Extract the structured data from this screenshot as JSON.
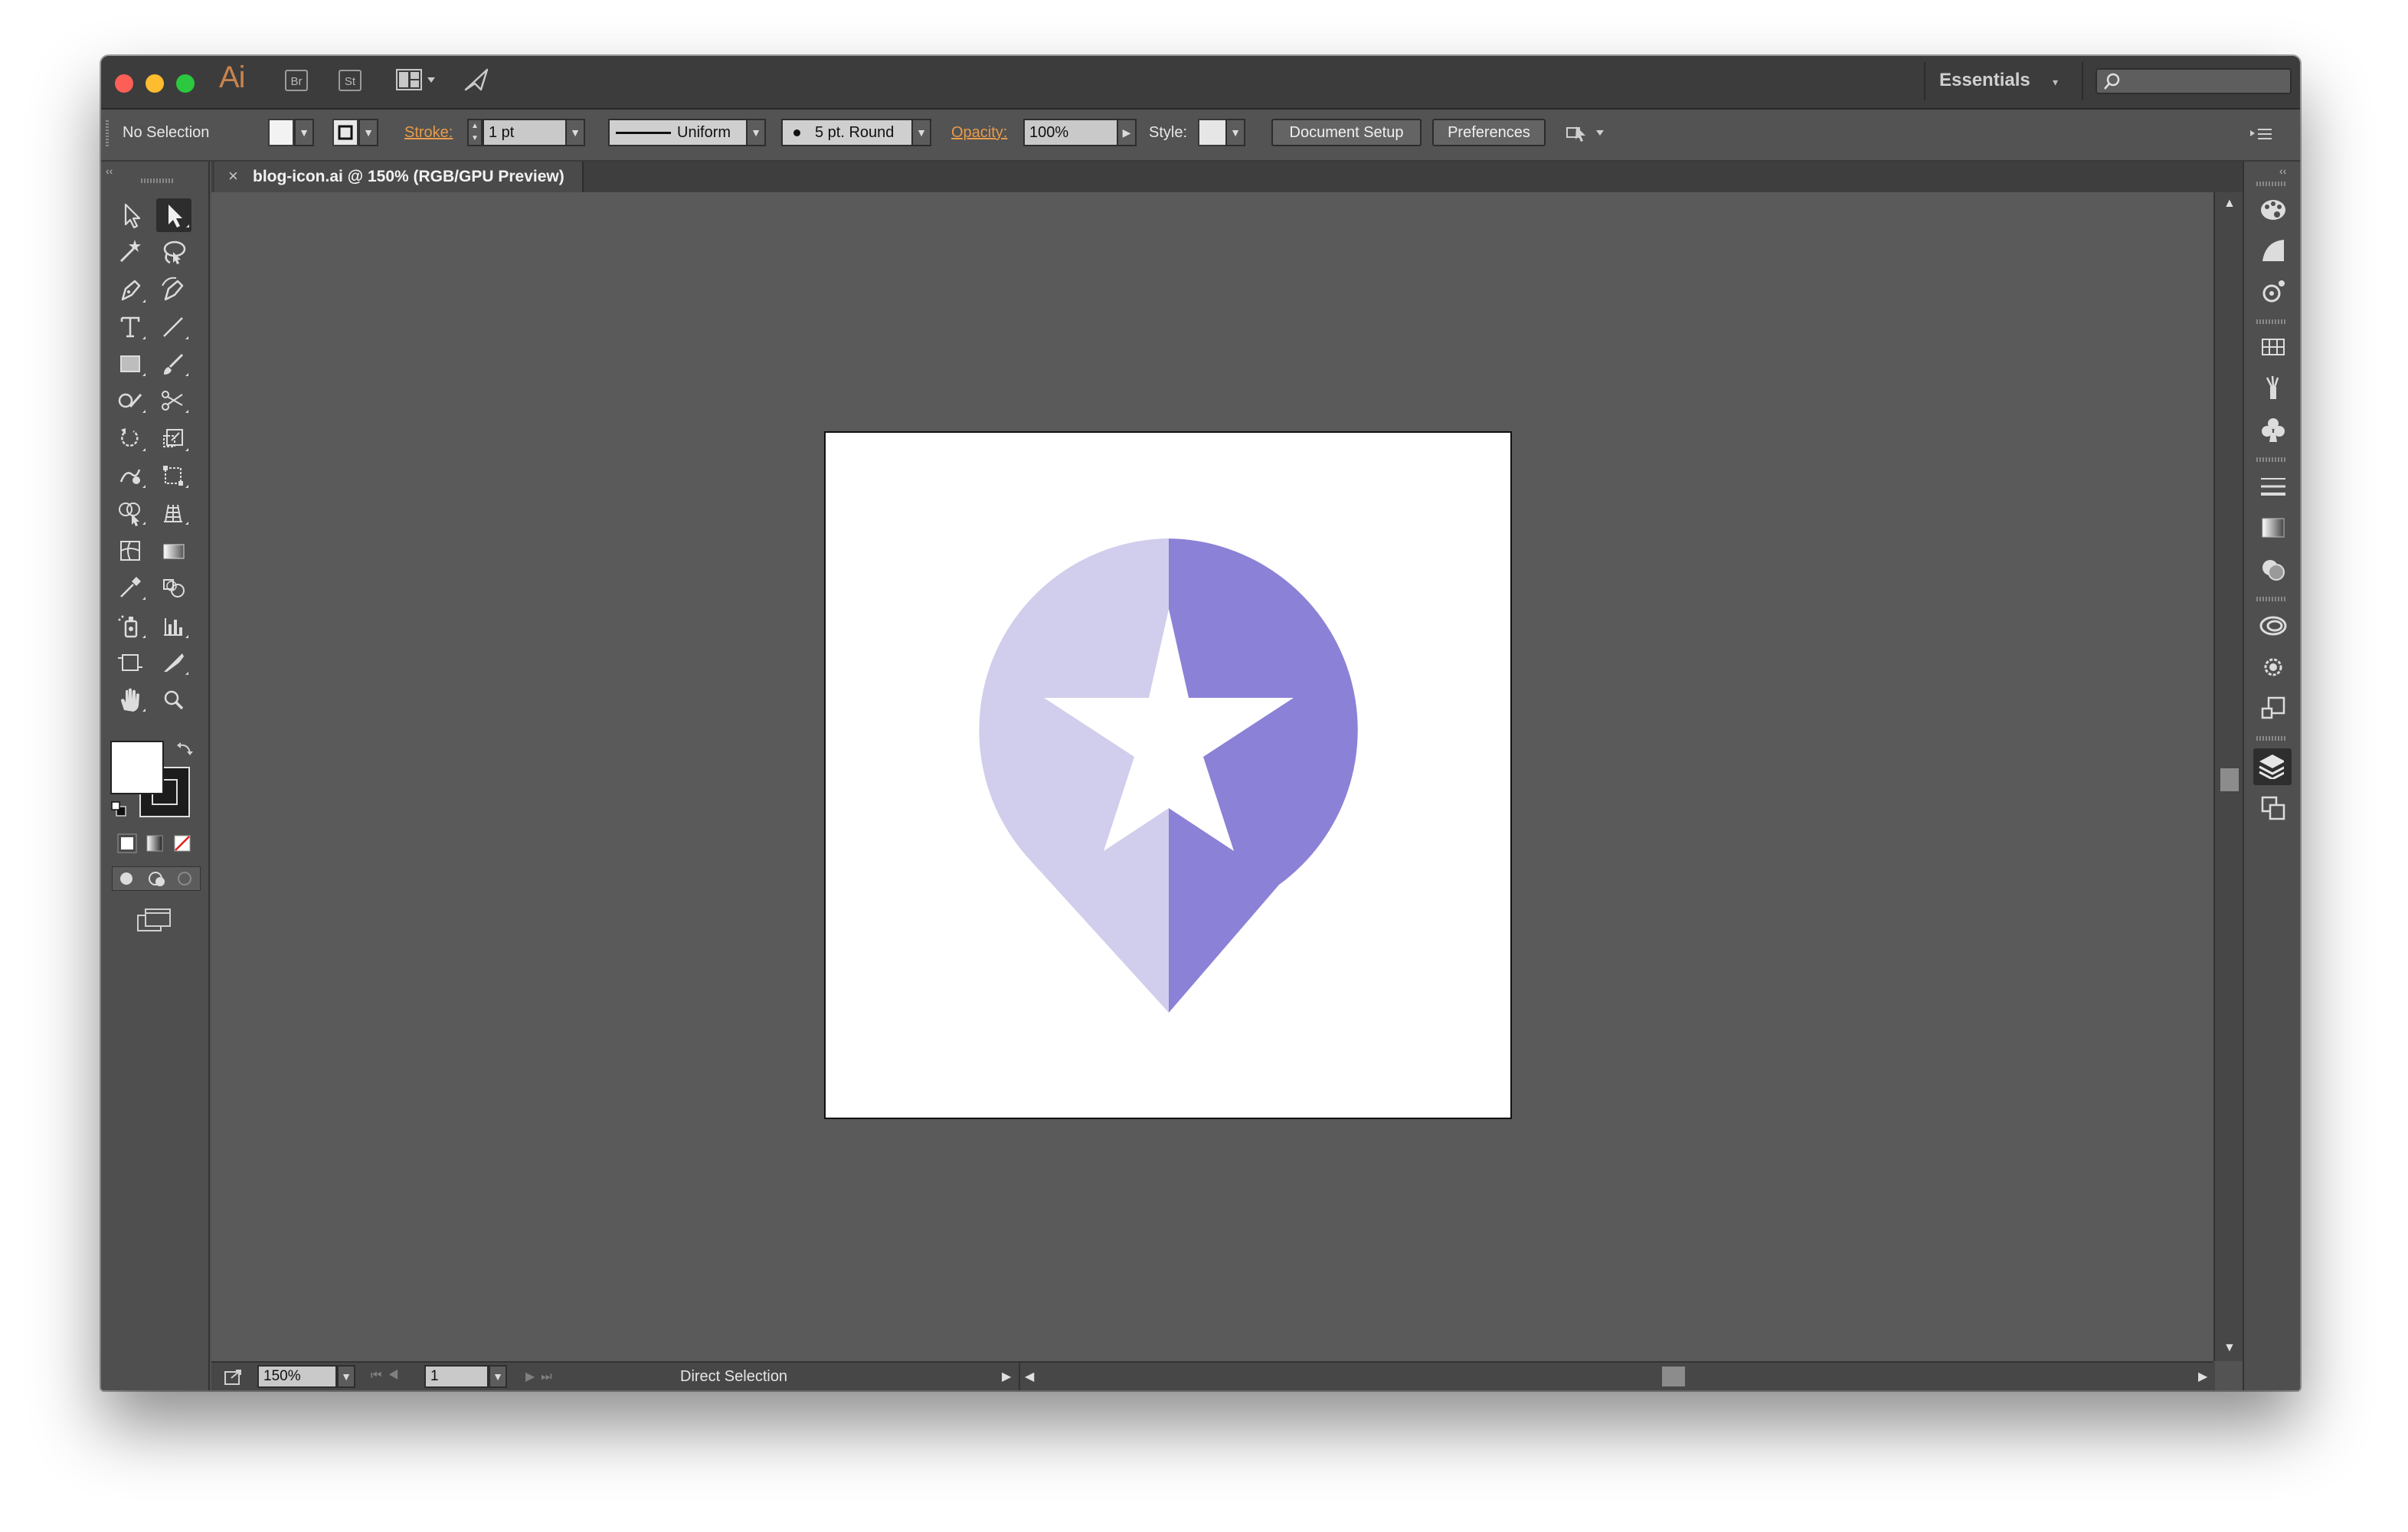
{
  "app": {
    "logo": "Ai",
    "bridge_label": "Br",
    "stock_label": "St",
    "workspace_label": "Essentials",
    "search_placeholder": ""
  },
  "control_bar": {
    "selection_label": "No Selection",
    "stroke_label": "Stroke:",
    "stroke_value": "1 pt",
    "profile_label": "Uniform",
    "brush_label": "5 pt. Round",
    "opacity_label": "Opacity:",
    "opacity_value": "100%",
    "style_label": "Style:",
    "document_setup_label": "Document Setup",
    "preferences_label": "Preferences"
  },
  "document": {
    "tab_close": "×",
    "tab_title": "blog-icon.ai @ 150% (RGB/GPU Preview)"
  },
  "artwork": {
    "pin_light_color": "#d1cdec",
    "pin_dark_color": "#8b81d6",
    "star_color": "#ffffff"
  },
  "status_bar": {
    "zoom_value": "150%",
    "artboard_value": "1",
    "tool_status": "Direct Selection"
  },
  "tools": {
    "fill_color": "#ffffff",
    "stroke_color": "#1c1c1c",
    "active_tool": "direct-selection-tool"
  }
}
